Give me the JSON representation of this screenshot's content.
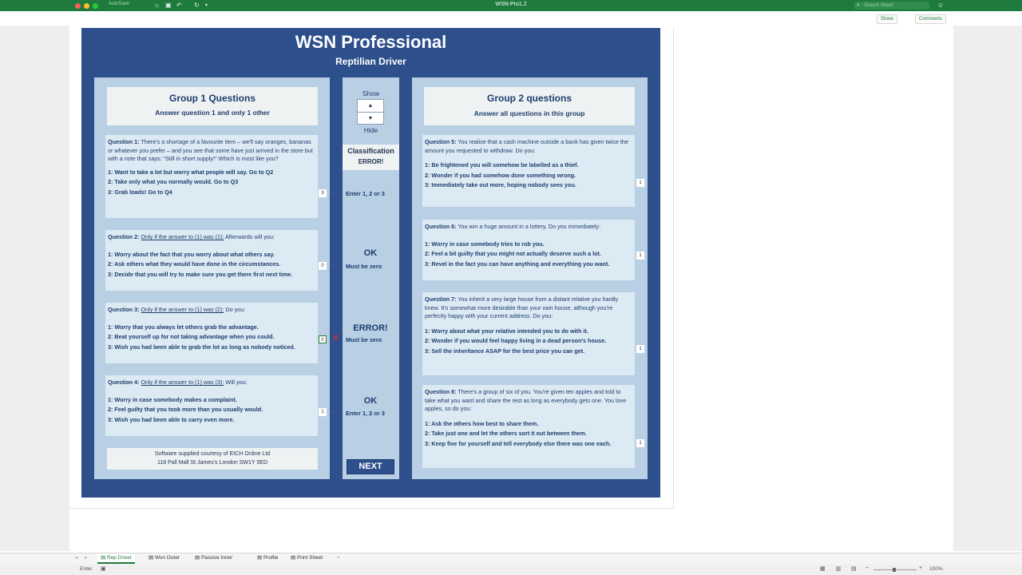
{
  "window": {
    "title": "WSN-Pro1.2",
    "autosave": "AutoSave",
    "search_placeholder": "Search Sheet",
    "share": "Share",
    "comments": "Comments"
  },
  "header": {
    "title": "WSN Professional",
    "subtitle": "Reptilian Driver"
  },
  "group1": {
    "title": "Group 1 Questions",
    "subtitle": "Answer question 1 and only 1 other",
    "questions": [
      {
        "head": "Question 1:",
        "text": "There's a shortage of a favourite item – we'll say oranges, bananas or whatever you prefer – and you see that some have just arrived  in the store but with a note that says: \"Still in short supply!\" Which is most like you?",
        "options": [
          "1: Want to take a lot but worry what people will say. Go to Q2",
          "2: Take only what you normally would. Go to Q3",
          "3: Grab loads! Go to Q4"
        ],
        "answer": "3"
      },
      {
        "head": "Question 2:",
        "cond": "Only if the answer to (1) was (1):",
        "text": "Afterwards will you:",
        "options": [
          "1: Worry about the fact that you worry about what others say.",
          "2: Ask others what they would have done in the circumstances.",
          "3: Decide that you will try to make sure you get there first next time."
        ],
        "answer": "0"
      },
      {
        "head": "Question 3:",
        "cond": "Only if the answer to (1) was (2):",
        "text": "Do you:",
        "options": [
          "1: Worry that you always let others grab the advantage.",
          "2: Beat yourself up for not taking advantage when you could.",
          "3: Wish you had been able to grab the lot as long as nobody noticed."
        ],
        "answer": "0"
      },
      {
        "head": "Question 4:",
        "cond": "Only if the answer to (1) was (3):",
        "text": "Will you:",
        "options": [
          "1: Worry in case somebody makes a complaint.",
          "2: Feel guilty that you took more than you usually would.",
          "3: Wish you had been able to carry even more."
        ],
        "answer": "1"
      }
    ],
    "footer_line1": "Software supplied courtesy of EICH Online  Ltd",
    "footer_line2": "118 Pall Mall St James's London SW1Y 5ED"
  },
  "middle": {
    "show": "Show",
    "hide": "Hide",
    "classification_label": "Classification",
    "classification_value": "ERROR!",
    "q1_hint": "Enter 1, 2 or 3",
    "q2_status": "OK",
    "q2_hint": "Must be zero",
    "q3_status": "ERROR!",
    "q3_hint": "Must be zero",
    "q3_mark": "X",
    "q4_status": "OK",
    "q4_hint": "Enter 1, 2 or 3",
    "next": "NEXT"
  },
  "group2": {
    "title": "Group 2 questions",
    "subtitle": "Answer all questions in this group",
    "questions": [
      {
        "head": "Question 5:",
        "text": "You realise that a cash machine outside a bank has given twice the amount you requested to withdraw. Do you:",
        "options": [
          "1: Be frightened you will somehow be labelled as a thief.",
          "2: Wonder if you had somehow done something wrong.",
          "3: Immediately take out more, hoping nobody sees you."
        ],
        "answer": "1"
      },
      {
        "head": "Question 6:",
        "text": "You win a huge amount in a lottery. Do you immediately:",
        "options": [
          "1: Worry in case somebody tries to rob you.",
          "2: Feel a bit guilty that you might not actually deserve such a lot.",
          "3: Revel in the fact you can have anything and everything you want."
        ],
        "answer": "1"
      },
      {
        "head": "Question 7:",
        "text": "You inherit a very large house from a distant relative you hardly knew. It's somewhat more desirable than your own house, although you're perfectly happy with your current address. Do you:",
        "options": [
          "1: Worry about what your relative intended you to do with it.",
          "2: Wonder if you would feel happy living in a dead person's house.",
          "3: Sell the inheritance ASAP for the best price you can get."
        ],
        "answer": "1"
      },
      {
        "head": "Question 8:",
        "text": "There's a group of six of you. You're given ten apples and told to take what you want and share the rest as long as everybody gets one. You love apples, so do you:",
        "options": [
          "1: Ask the others how best to share them.",
          "2: Take just one and let the others sort it out between them.",
          "3: Keep five for yourself and tell everybody else there was one each."
        ],
        "answer": "1"
      }
    ]
  },
  "sheet_tabs": [
    "Rep Driver",
    "Wsn Outer",
    "Passive Inner",
    "Profile",
    "Print Sheet"
  ],
  "status": {
    "mode": "Enter",
    "zoom": "100%"
  }
}
